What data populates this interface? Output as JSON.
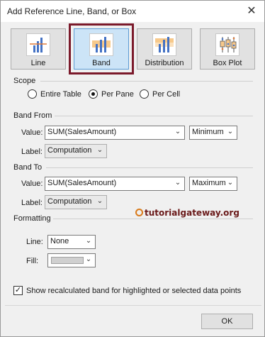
{
  "window": {
    "title": "Add Reference Line, Band, or Box"
  },
  "types": [
    {
      "label": "Line",
      "icon": "reference-line-icon",
      "selected": false
    },
    {
      "label": "Band",
      "icon": "reference-band-icon",
      "selected": true
    },
    {
      "label": "Distribution",
      "icon": "distribution-icon",
      "selected": false
    },
    {
      "label": "Box Plot",
      "icon": "box-plot-icon",
      "selected": false
    }
  ],
  "scope": {
    "heading": "Scope",
    "options": [
      {
        "label": "Entire Table",
        "selected": false
      },
      {
        "label": "Per Pane",
        "selected": true
      },
      {
        "label": "Per Cell",
        "selected": false
      }
    ]
  },
  "band_from": {
    "heading": "Band From",
    "value_label": "Value:",
    "value": "SUM(SalesAmount)",
    "aggregation": "Minimum",
    "label_label": "Label:",
    "label_value": "Computation"
  },
  "band_to": {
    "heading": "Band To",
    "value_label": "Value:",
    "value": "SUM(SalesAmount)",
    "aggregation": "Maximum",
    "label_label": "Label:",
    "label_value": "Computation"
  },
  "formatting": {
    "heading": "Formatting",
    "line_label": "Line:",
    "line_value": "None",
    "fill_label": "Fill:",
    "fill_color": "#d0d0d0"
  },
  "watermark": "tutorialgateway.org",
  "recalc": {
    "label": "Show recalculated band for highlighted or selected data points",
    "checked": true
  },
  "ok_label": "OK",
  "colors": {
    "highlight_border": "#7b1a2b",
    "selected_bg": "#cce4f7",
    "accent": "#4472c4"
  }
}
